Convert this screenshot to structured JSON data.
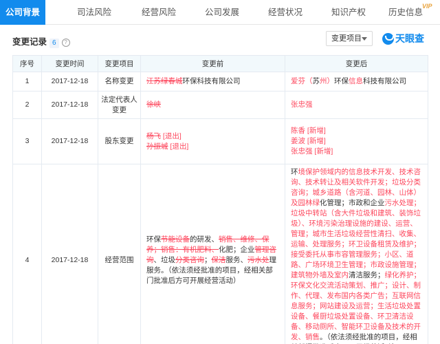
{
  "tabs": [
    {
      "label": "公司背景",
      "active": true
    },
    {
      "label": "司法风险"
    },
    {
      "label": "经营风险"
    },
    {
      "label": "公司发展"
    },
    {
      "label": "经营状况"
    },
    {
      "label": "知识产权"
    },
    {
      "label": "历史信息"
    }
  ],
  "vip_badge": "VIP",
  "section": {
    "title": "变更记录",
    "count": "6",
    "help": "?"
  },
  "filter": {
    "label": "变更项目"
  },
  "logo": {
    "text": "天眼查"
  },
  "table": {
    "headers": [
      "序号",
      "变更时间",
      "变更项目",
      "变更前",
      "变更后"
    ],
    "rows": [
      {
        "index": "1",
        "date": "2017-12-18",
        "item": "名称变更",
        "before": {
          "struck": "江苏绿春城",
          "plain": "环保科技有限公司"
        },
        "after": {
          "hl1": "爱芬（",
          "mid": "苏",
          "hl2": "州）",
          "plain1": "环保",
          "hl3": "信息",
          "plain2": "科技有限公司"
        }
      },
      {
        "index": "2",
        "date": "2017-12-18",
        "item": "法定代表人变更",
        "before": {
          "struck": "徐峡"
        },
        "after": {
          "name": "张忠强"
        }
      },
      {
        "index": "3",
        "date": "2017-12-18",
        "item": "股东变更",
        "before": {
          "lines": [
            {
              "name": "杨飞",
              "tag": "[退出]"
            },
            {
              "name": "孙振城",
              "tag": "[退出]"
            }
          ]
        },
        "after": {
          "lines": [
            {
              "name": "陈香",
              "tag": "[新增]"
            },
            {
              "name": "姜波",
              "tag": "[新增]"
            },
            {
              "name": "张忠强",
              "tag": "[新增]"
            }
          ]
        }
      },
      {
        "index": "4",
        "date": "2017-12-18",
        "item": "经营范围",
        "before": {
          "p1": "环保",
          "s1": "节能设备",
          "p2": "的研发、",
          "s2": "销售、维修、保养；销售：有机肥料、",
          "p3": "化肥；企业",
          "s3": "管理咨询",
          "p4": "、垃圾",
          "s4": "分类咨询",
          "p5": "；",
          "s5": "保洁",
          "p6": "服务、",
          "s6": "污水处",
          "p7": "理服务。（依法须经批准的项目，经相关部门批准后方可开展经营活动）"
        },
        "after": {
          "p1": "环",
          "h1": "境保护领域内的信息技术开发、技术咨询、技术转让及相关软件开发；垃圾分类咨询；城乡道路（含河道、园林、山体）及园林绿",
          "p2": "化管理；市政和企业",
          "h2": "污水",
          "p3": "处理；垃圾中转站（含大件垃圾和建筑、装饰垃圾）、环境污染治理设施的建设、运营、管理；城市生活垃圾经营性清扫、收集、运输、处理服务；环卫设备租赁及维护；接受委托从事市容管理服务；小区、道路、广场环境卫生管理；市政设施管理；建筑物外墙及室内",
          "p4": "清洁服务；",
          "h3": "绿化养护；环保文化交流活动策划、推广；设计、制作、代理、发布国内各类广告；互联网信息服务；网站建设及运营；生活垃圾处置设备、餐厨垃圾处置设备、环卫清洁设备、移动厕所、智能环卫设备及技术的开发、销售",
          "p5": "。（依法须经批准的项目，经相关部门批准后方可开展经营活动）"
        }
      }
    ]
  },
  "colors": {
    "accent": "#128bed",
    "highlight": "#fd485e",
    "header_bg": "#f2f9fc"
  }
}
